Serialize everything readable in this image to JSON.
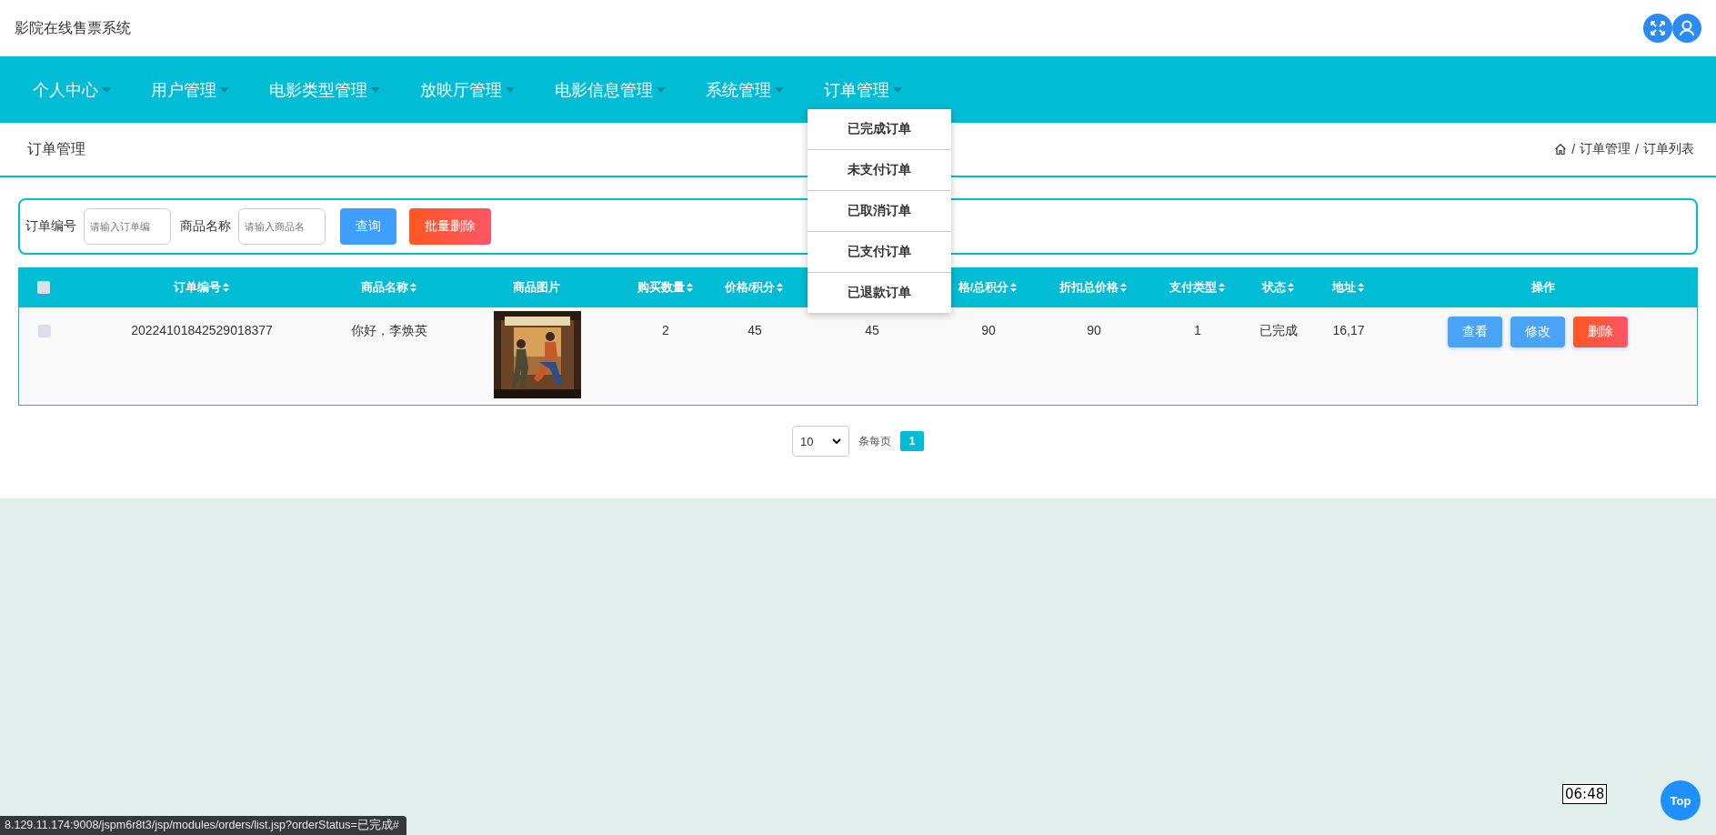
{
  "app_title": "影院在线售票系统",
  "nav": {
    "items": [
      {
        "label": "个人中心"
      },
      {
        "label": "用户管理"
      },
      {
        "label": "电影类型管理"
      },
      {
        "label": "放映厅管理"
      },
      {
        "label": "电影信息管理"
      },
      {
        "label": "系统管理"
      },
      {
        "label": "订单管理",
        "menu": [
          "已完成订单",
          "未支付订单",
          "已取消订单",
          "已支付订单",
          "已退款订单"
        ]
      }
    ]
  },
  "page_title": "订单管理",
  "breadcrumb": {
    "separator": "/",
    "items": [
      "订单管理",
      "订单列表"
    ]
  },
  "search": {
    "fields": [
      {
        "label": "订单编号",
        "placeholder": "请输入订单编"
      },
      {
        "label": "商品名称",
        "placeholder": "请输入商品名"
      }
    ],
    "buttons": [
      {
        "label": "查询",
        "kind": "primary"
      },
      {
        "label": "批量删除",
        "kind": "danger"
      }
    ]
  },
  "table": {
    "columns": [
      {
        "kind": "checkbox",
        "checked": false
      },
      {
        "kind": "sort",
        "label": "订单编号"
      },
      {
        "kind": "sort",
        "label": "商品名称"
      },
      {
        "kind": "plain",
        "label": "商品图片"
      },
      {
        "kind": "sort",
        "label": "购买数量"
      },
      {
        "kind": "sort",
        "label": "价格/积分"
      },
      {
        "kind": "covered"
      },
      {
        "kind": "sort",
        "label": "格/总积分"
      },
      {
        "kind": "sort",
        "label": "折扣总价格"
      },
      {
        "kind": "sort",
        "label": "支付类型"
      },
      {
        "kind": "sort",
        "label": "状态"
      },
      {
        "kind": "sort",
        "label": "地址"
      },
      {
        "kind": "plain",
        "label": "操作"
      }
    ],
    "rows": [
      {
        "cells": [
          {
            "kind": "checkbox",
            "checked": false
          },
          {
            "kind": "text",
            "text": "20224101842529018377"
          },
          {
            "kind": "text",
            "text": "你好，李焕英"
          },
          {
            "kind": "picture"
          },
          {
            "kind": "text",
            "text": "2"
          },
          {
            "kind": "text",
            "text": "45"
          },
          {
            "kind": "text",
            "text": "45"
          },
          {
            "kind": "text",
            "text": "90"
          },
          {
            "kind": "text",
            "text": "90"
          },
          {
            "kind": "text",
            "text": "1"
          },
          {
            "kind": "text",
            "text": "已完成"
          },
          {
            "kind": "text",
            "text": "16,17"
          },
          {
            "kind": "actions",
            "buttons": [
              {
                "label": "查看",
                "kind": "primary"
              },
              {
                "label": "修改",
                "kind": "primary"
              },
              {
                "label": "删除",
                "kind": "danger"
              }
            ]
          }
        ]
      }
    ]
  },
  "pager": {
    "page_size": "10",
    "per_page_label": "条每页",
    "pages": [
      {
        "label": "1",
        "selected": true
      }
    ]
  },
  "status_url": "8.129.11.174:9008/jspm6r8t3/jsp/modules/orders/list.jsp?orderStatus=已完成#",
  "time_tooltip": "06:48",
  "top_button": "Top"
}
